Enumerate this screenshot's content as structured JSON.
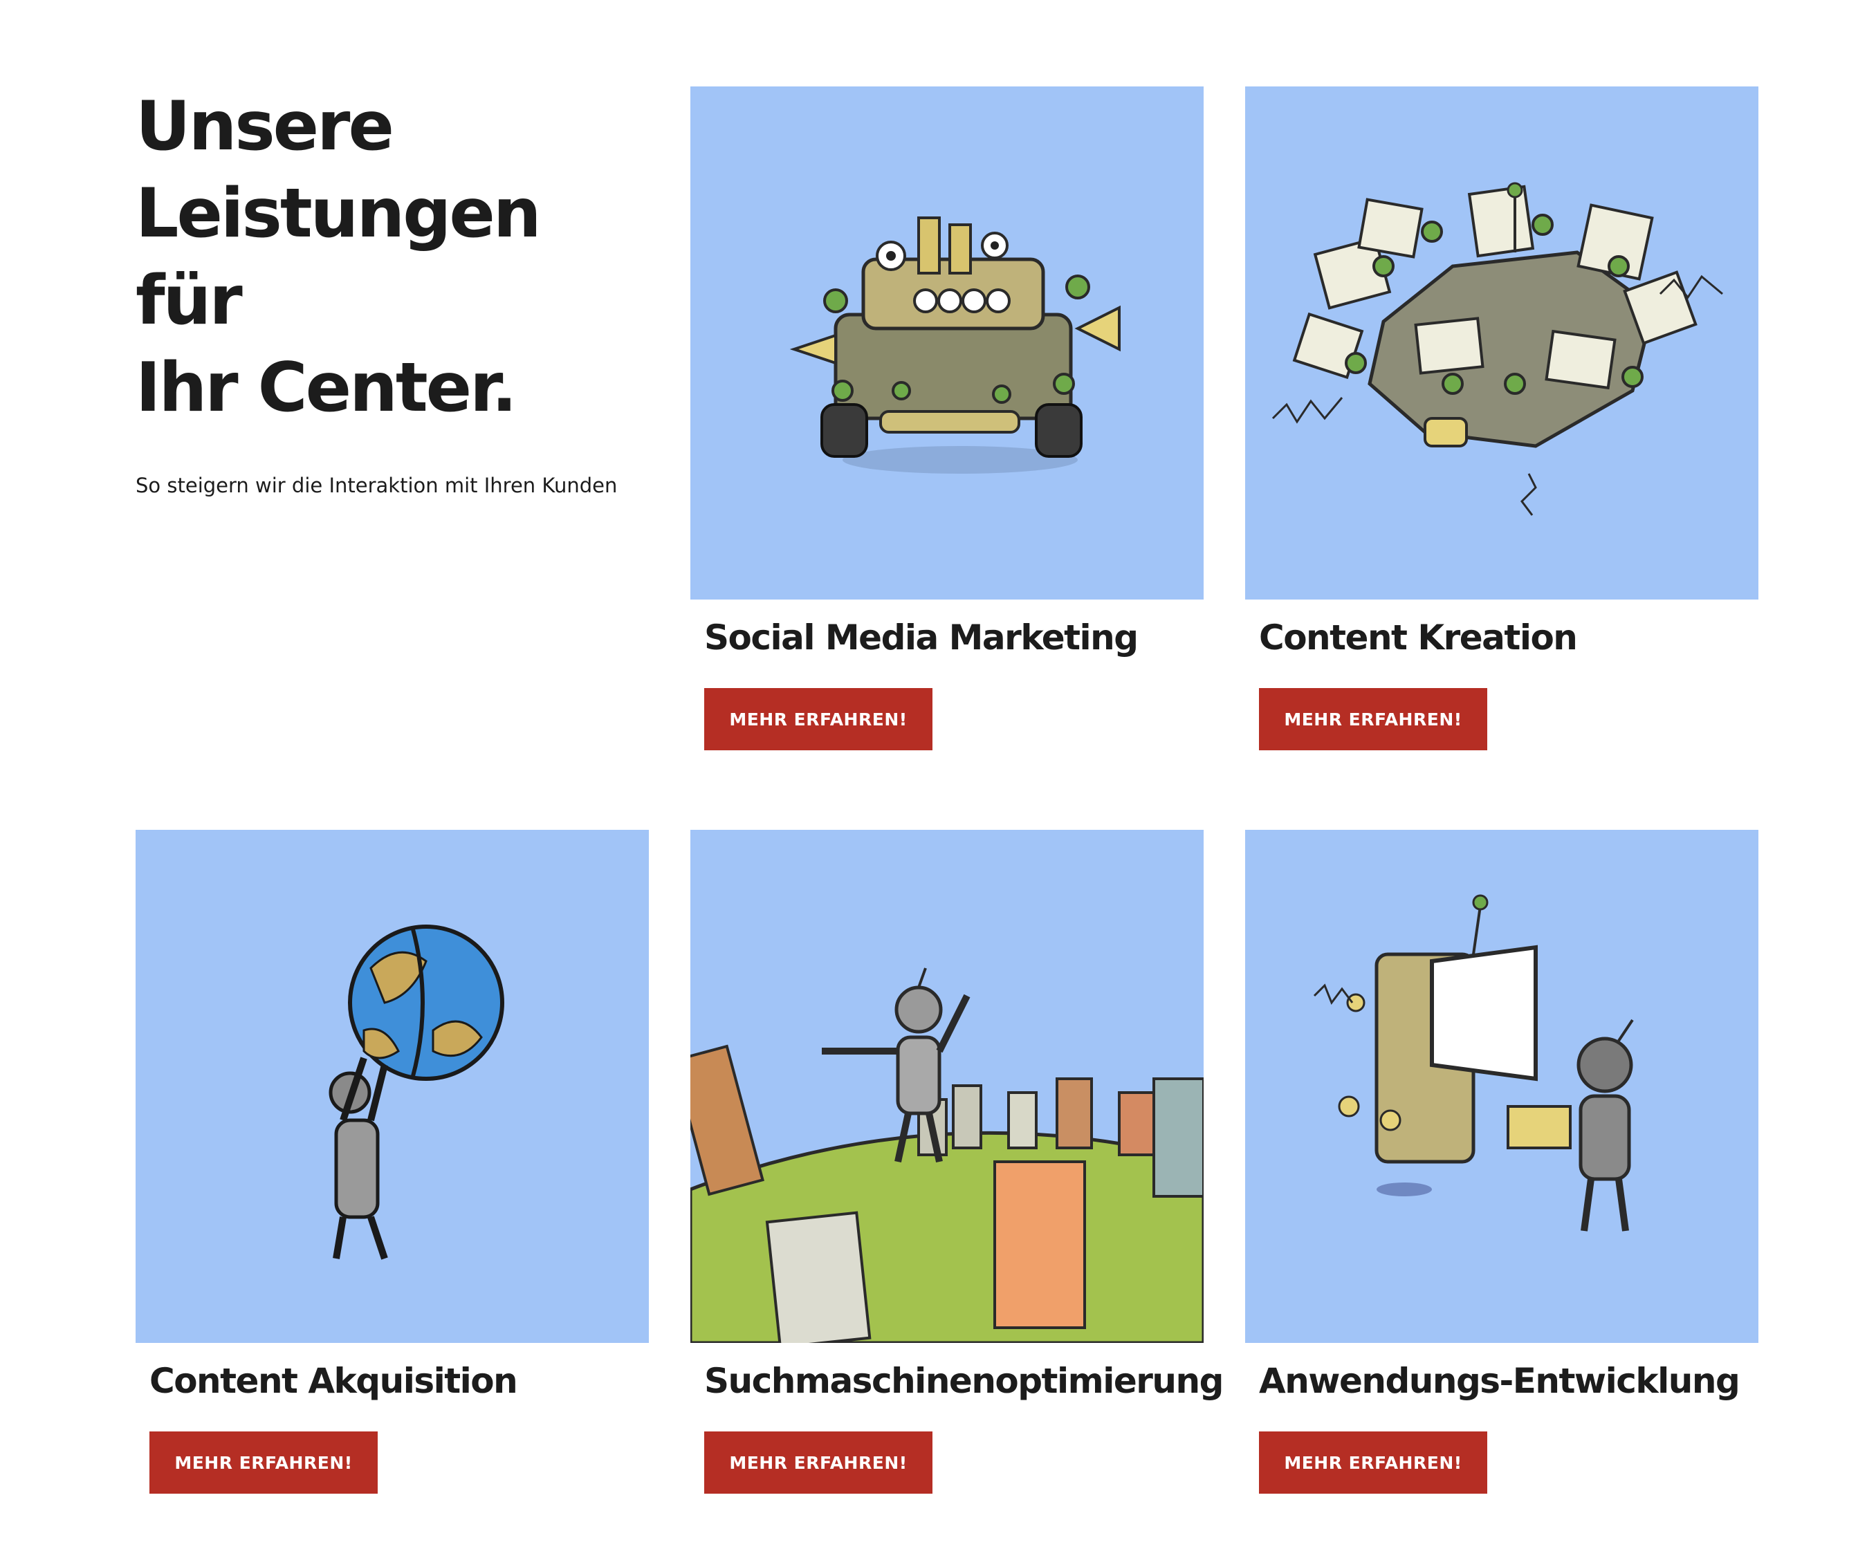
{
  "intro": {
    "heading_line1": "Unsere",
    "heading_line2": "Leistungen für",
    "heading_line3": "Ihr Center.",
    "subtitle": "So steigern wir die Interaktion mit Ihren Kunden"
  },
  "colors": {
    "image_background": "#a1c4f7",
    "button": "#b52e24",
    "heading": "#1c1c1c"
  },
  "cards": [
    {
      "title": "Social Media Marketing",
      "button": "MEHR ERFAHREN!",
      "illustration": "robot-vehicle-illustration"
    },
    {
      "title": "Content Kreation",
      "button": "MEHR ERFAHREN!",
      "illustration": "content-machine-illustration"
    },
    {
      "title": "Content Akquisition",
      "button": "MEHR ERFAHREN!",
      "illustration": "robot-holding-globe-illustration"
    },
    {
      "title": "Suchmaschinenoptimierung",
      "button": "MEHR ERFAHREN!",
      "illustration": "robot-among-doors-illustration"
    },
    {
      "title": "Anwendungs-Entwicklung",
      "button": "MEHR ERFAHREN!",
      "illustration": "robot-building-machine-illustration"
    }
  ]
}
